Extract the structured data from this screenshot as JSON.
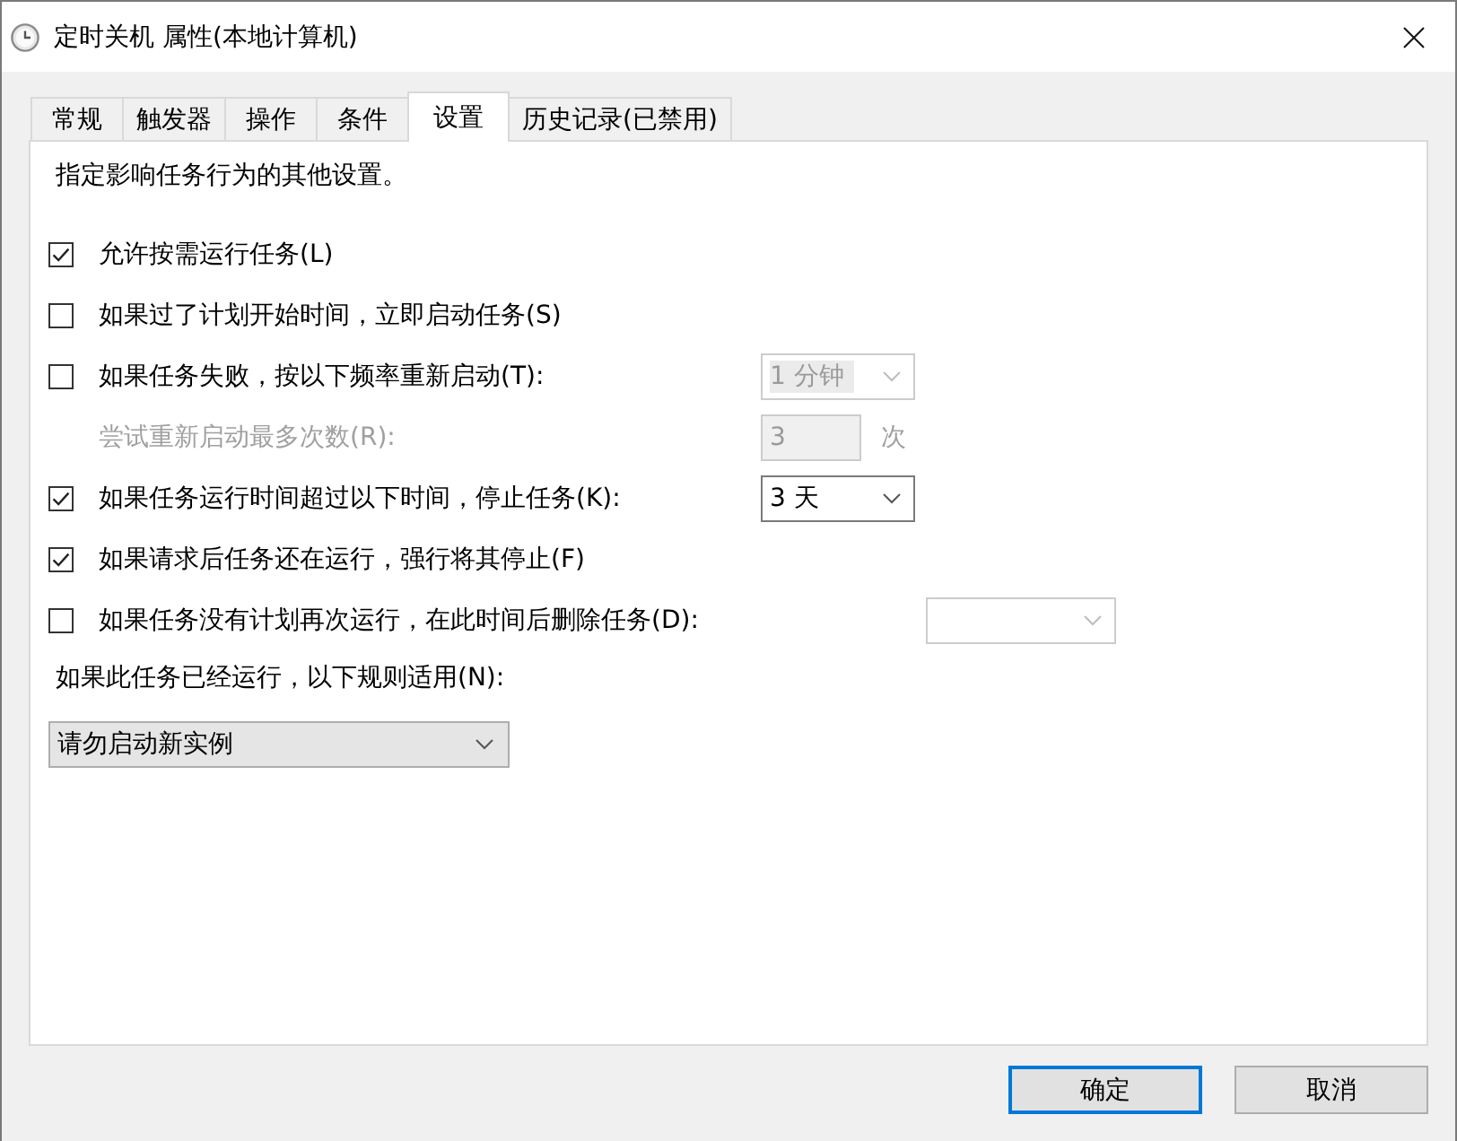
{
  "window": {
    "title": "定时关机 属性(本地计算机)"
  },
  "tabs": [
    {
      "label": "常规",
      "selected": false
    },
    {
      "label": "触发器",
      "selected": false
    },
    {
      "label": "操作",
      "selected": false
    },
    {
      "label": "条件",
      "selected": false
    },
    {
      "label": "设置",
      "selected": true
    },
    {
      "label": "历史记录(已禁用)",
      "selected": false
    }
  ],
  "settings": {
    "description": "指定影响任务行为的其他设置。",
    "options": [
      {
        "kind": "checkbox",
        "label": "允许按需运行任务(L)",
        "checked": true
      },
      {
        "kind": "checkbox",
        "label": "如果过了计划开始时间，立即启动任务(S)",
        "checked": false
      },
      {
        "kind": "checkbox",
        "label": "如果任务失败，按以下频率重新启动(T):",
        "checked": false,
        "dropdown": {
          "value": "1 分钟",
          "disabled": true
        }
      },
      {
        "kind": "number",
        "label": "尝试重新启动最多次数(R):",
        "disabled": true,
        "value": "3",
        "unit": "次"
      },
      {
        "kind": "checkbox",
        "label": "如果任务运行时间超过以下时间，停止任务(K):",
        "checked": true,
        "dropdown": {
          "value": "3 天",
          "disabled": false
        }
      },
      {
        "kind": "checkbox",
        "label": "如果请求后任务还在运行，强行将其停止(F)",
        "checked": true
      },
      {
        "kind": "checkbox",
        "label": "如果任务没有计划再次运行，在此时间后删除任务(D):",
        "checked": false,
        "dropdown": {
          "disabled": true
        }
      }
    ],
    "rule_label": "如果此任务已经运行，以下规则适用(N):",
    "rule_dropdown": {
      "value": "请勿启动新实例"
    }
  },
  "buttons": [
    {
      "label": "确定",
      "default": true
    },
    {
      "label": "取消",
      "default": false
    }
  ]
}
